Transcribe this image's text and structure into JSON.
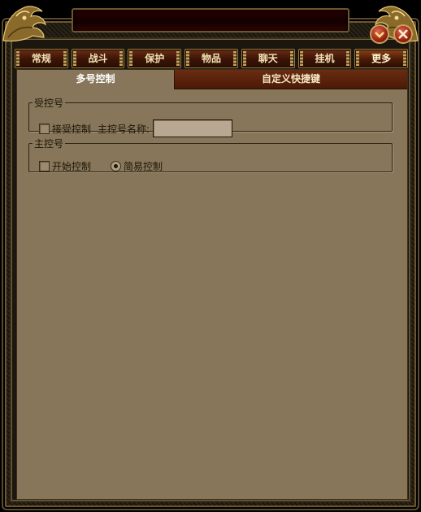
{
  "tabs": [
    {
      "label": "常规"
    },
    {
      "label": "战斗"
    },
    {
      "label": "保护"
    },
    {
      "label": "物品"
    },
    {
      "label": "聊天"
    },
    {
      "label": "挂机"
    },
    {
      "label": "更多"
    }
  ],
  "active_tab": "更多",
  "subtabs": {
    "multi_control": "多号控制",
    "custom_hotkeys": "自定义快捷键"
  },
  "controlled_group": {
    "legend": "受控号",
    "accept_control_label": "接受控制",
    "accept_control_checked": false,
    "master_name_label": "主控号名称:",
    "master_name_value": ""
  },
  "master_group": {
    "legend": "主控号",
    "start_control_label": "开始控制",
    "start_control_checked": false,
    "simple_control_label": "简易控制",
    "simple_control_selected": true
  },
  "buttons": {
    "minimize_icon": "chevron-down-icon",
    "close_icon": "close-icon"
  },
  "colors": {
    "panel_bg": "#87765a",
    "tab_bg": "#3a1406",
    "tab_text": "#f4e2b4",
    "frame_gold": "#c9a25a",
    "close_red": "#9a2412"
  }
}
